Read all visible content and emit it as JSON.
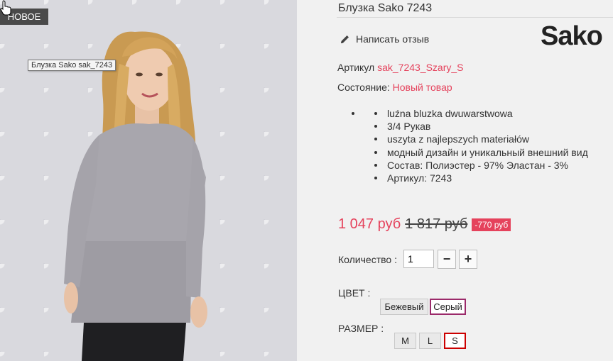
{
  "image": {
    "badge_label": "НОВОЕ",
    "tooltip": "Блузка Sako sak_7243"
  },
  "product": {
    "title": "Блузка Sako 7243",
    "review_link": "Написать отзыв",
    "brand_logo": "Sako",
    "sku_label": "Артикул",
    "sku_value": "sak_7243_Szary_S",
    "condition_label": "Состояние:",
    "condition_value": "Новый товар",
    "features": [
      "luźna bluzka dwuwarstwowa",
      "3/4 Рукав",
      "uszyta z najlepszych materiałów",
      "модный дизайн и уникальный внешний вид",
      "Состав: Полиэстер - 97% Эластан - 3%",
      "Артикул: 7243"
    ]
  },
  "pricing": {
    "price": "1 047 руб",
    "old_price": "1 817 руб",
    "discount": "-770 руб"
  },
  "quantity": {
    "label": "Количество :",
    "value": "1",
    "minus": "−",
    "plus": "+"
  },
  "color": {
    "label": "ЦВЕТ :",
    "options": [
      "Бежевый",
      "Серый"
    ],
    "selected": "Серый"
  },
  "size": {
    "label": "РАЗМЕР :",
    "options": [
      "M",
      "L",
      "S"
    ],
    "selected": "S"
  },
  "colors": {
    "accent": "#e5425c",
    "selected_size_border": "#cc0000",
    "selected_color_border": "#9b2a6a"
  }
}
